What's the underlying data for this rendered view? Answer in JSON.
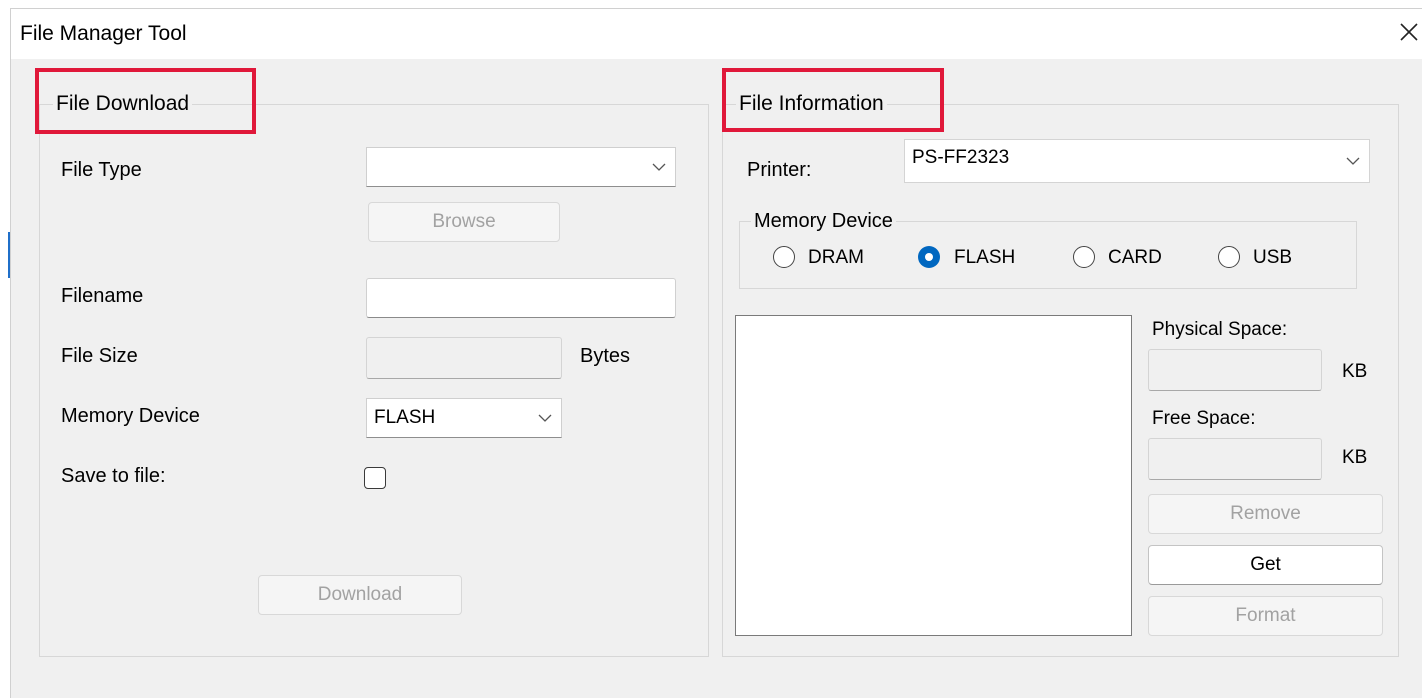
{
  "window": {
    "title": "File Manager Tool",
    "close_icon": "close-icon"
  },
  "download": {
    "legend": "File Download",
    "file_type_label": "File Type",
    "file_type_value": "",
    "browse_label": "Browse",
    "filename_label": "Filename",
    "filename_value": "",
    "file_size_label": "File Size",
    "file_size_value": "",
    "bytes_unit": "Bytes",
    "memory_device_label": "Memory Device",
    "memory_device_value": "FLASH",
    "save_to_file_label": "Save to file:",
    "save_to_file_checked": false,
    "download_label": "Download"
  },
  "info": {
    "legend": "File Information",
    "printer_label": "Printer:",
    "printer_value": "PS-FF2323",
    "memory_group_label": "Memory Device",
    "radios": [
      {
        "label": "DRAM",
        "checked": false
      },
      {
        "label": "FLASH",
        "checked": true
      },
      {
        "label": "CARD",
        "checked": false
      },
      {
        "label": "USB",
        "checked": false
      }
    ],
    "physical_space_label": "Physical Space:",
    "physical_space_value": "",
    "physical_unit": "KB",
    "free_space_label": "Free Space:",
    "free_space_value": "",
    "free_unit": "KB",
    "remove_label": "Remove",
    "get_label": "Get",
    "format_label": "Format"
  },
  "colors": {
    "highlight_box": "#e0183a",
    "radio_accent": "#0067c0",
    "window_bg": "#f0f0f0"
  }
}
